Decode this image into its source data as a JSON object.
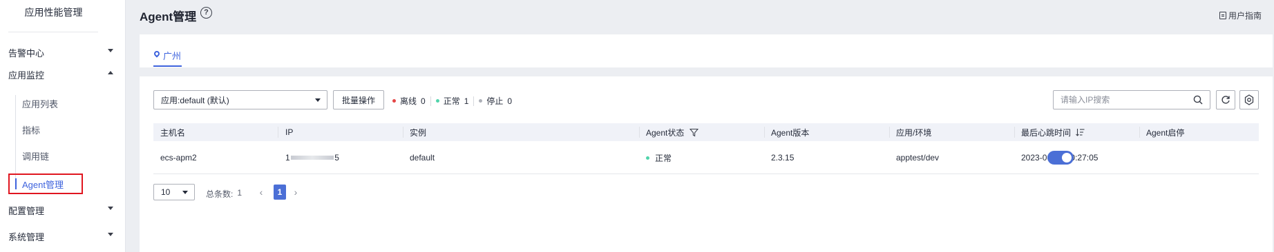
{
  "sidebar": {
    "title": "应用性能管理",
    "items": [
      {
        "label": "告警中心",
        "expanded": false
      },
      {
        "label": "应用监控",
        "expanded": true
      },
      {
        "label": "配置管理",
        "expanded": false
      },
      {
        "label": "系统管理",
        "expanded": false
      }
    ],
    "sub_items": [
      {
        "label": "应用列表"
      },
      {
        "label": "指标"
      },
      {
        "label": "调用链"
      },
      {
        "label": "Agent管理",
        "active": true
      }
    ]
  },
  "header": {
    "title": "Agent管理",
    "help_icon": "question-circle-icon",
    "guide_label": "用户指南",
    "guide_icon": "document-edit-icon"
  },
  "region_tabs": [
    {
      "label": "广州",
      "icon": "location-pin-icon",
      "active": true
    }
  ],
  "toolbar": {
    "app_select_value": "应用:default (默认)",
    "batch_label": "批量操作",
    "status": [
      {
        "label": "离线",
        "count": "0",
        "color": "#e54545"
      },
      {
        "label": "正常",
        "count": "1",
        "color": "#50d4ab"
      },
      {
        "label": "停止",
        "count": "0",
        "color": "#adb0b8"
      }
    ],
    "search_placeholder": "请输入IP搜索",
    "refresh_icon": "refresh-icon",
    "settings_icon": "gear-icon"
  },
  "table": {
    "columns": [
      "主机名",
      "IP",
      "实例",
      "Agent状态",
      "Agent版本",
      "应用/环境",
      "最后心跳时间",
      "Agent启停"
    ],
    "rows": [
      {
        "hostname": "ecs-apm2",
        "ip_prefix": "1",
        "ip_suffix": "5",
        "instance": "default",
        "status": "正常",
        "status_color": "#50d4ab",
        "version": "2.3.15",
        "app_env": "apptest/dev",
        "last_heartbeat": "2023-06-29 20:27:05",
        "enabled": true
      }
    ]
  },
  "pagination": {
    "page_size": "10",
    "total_label": "总条数:",
    "total": "1",
    "current_page": "1"
  }
}
